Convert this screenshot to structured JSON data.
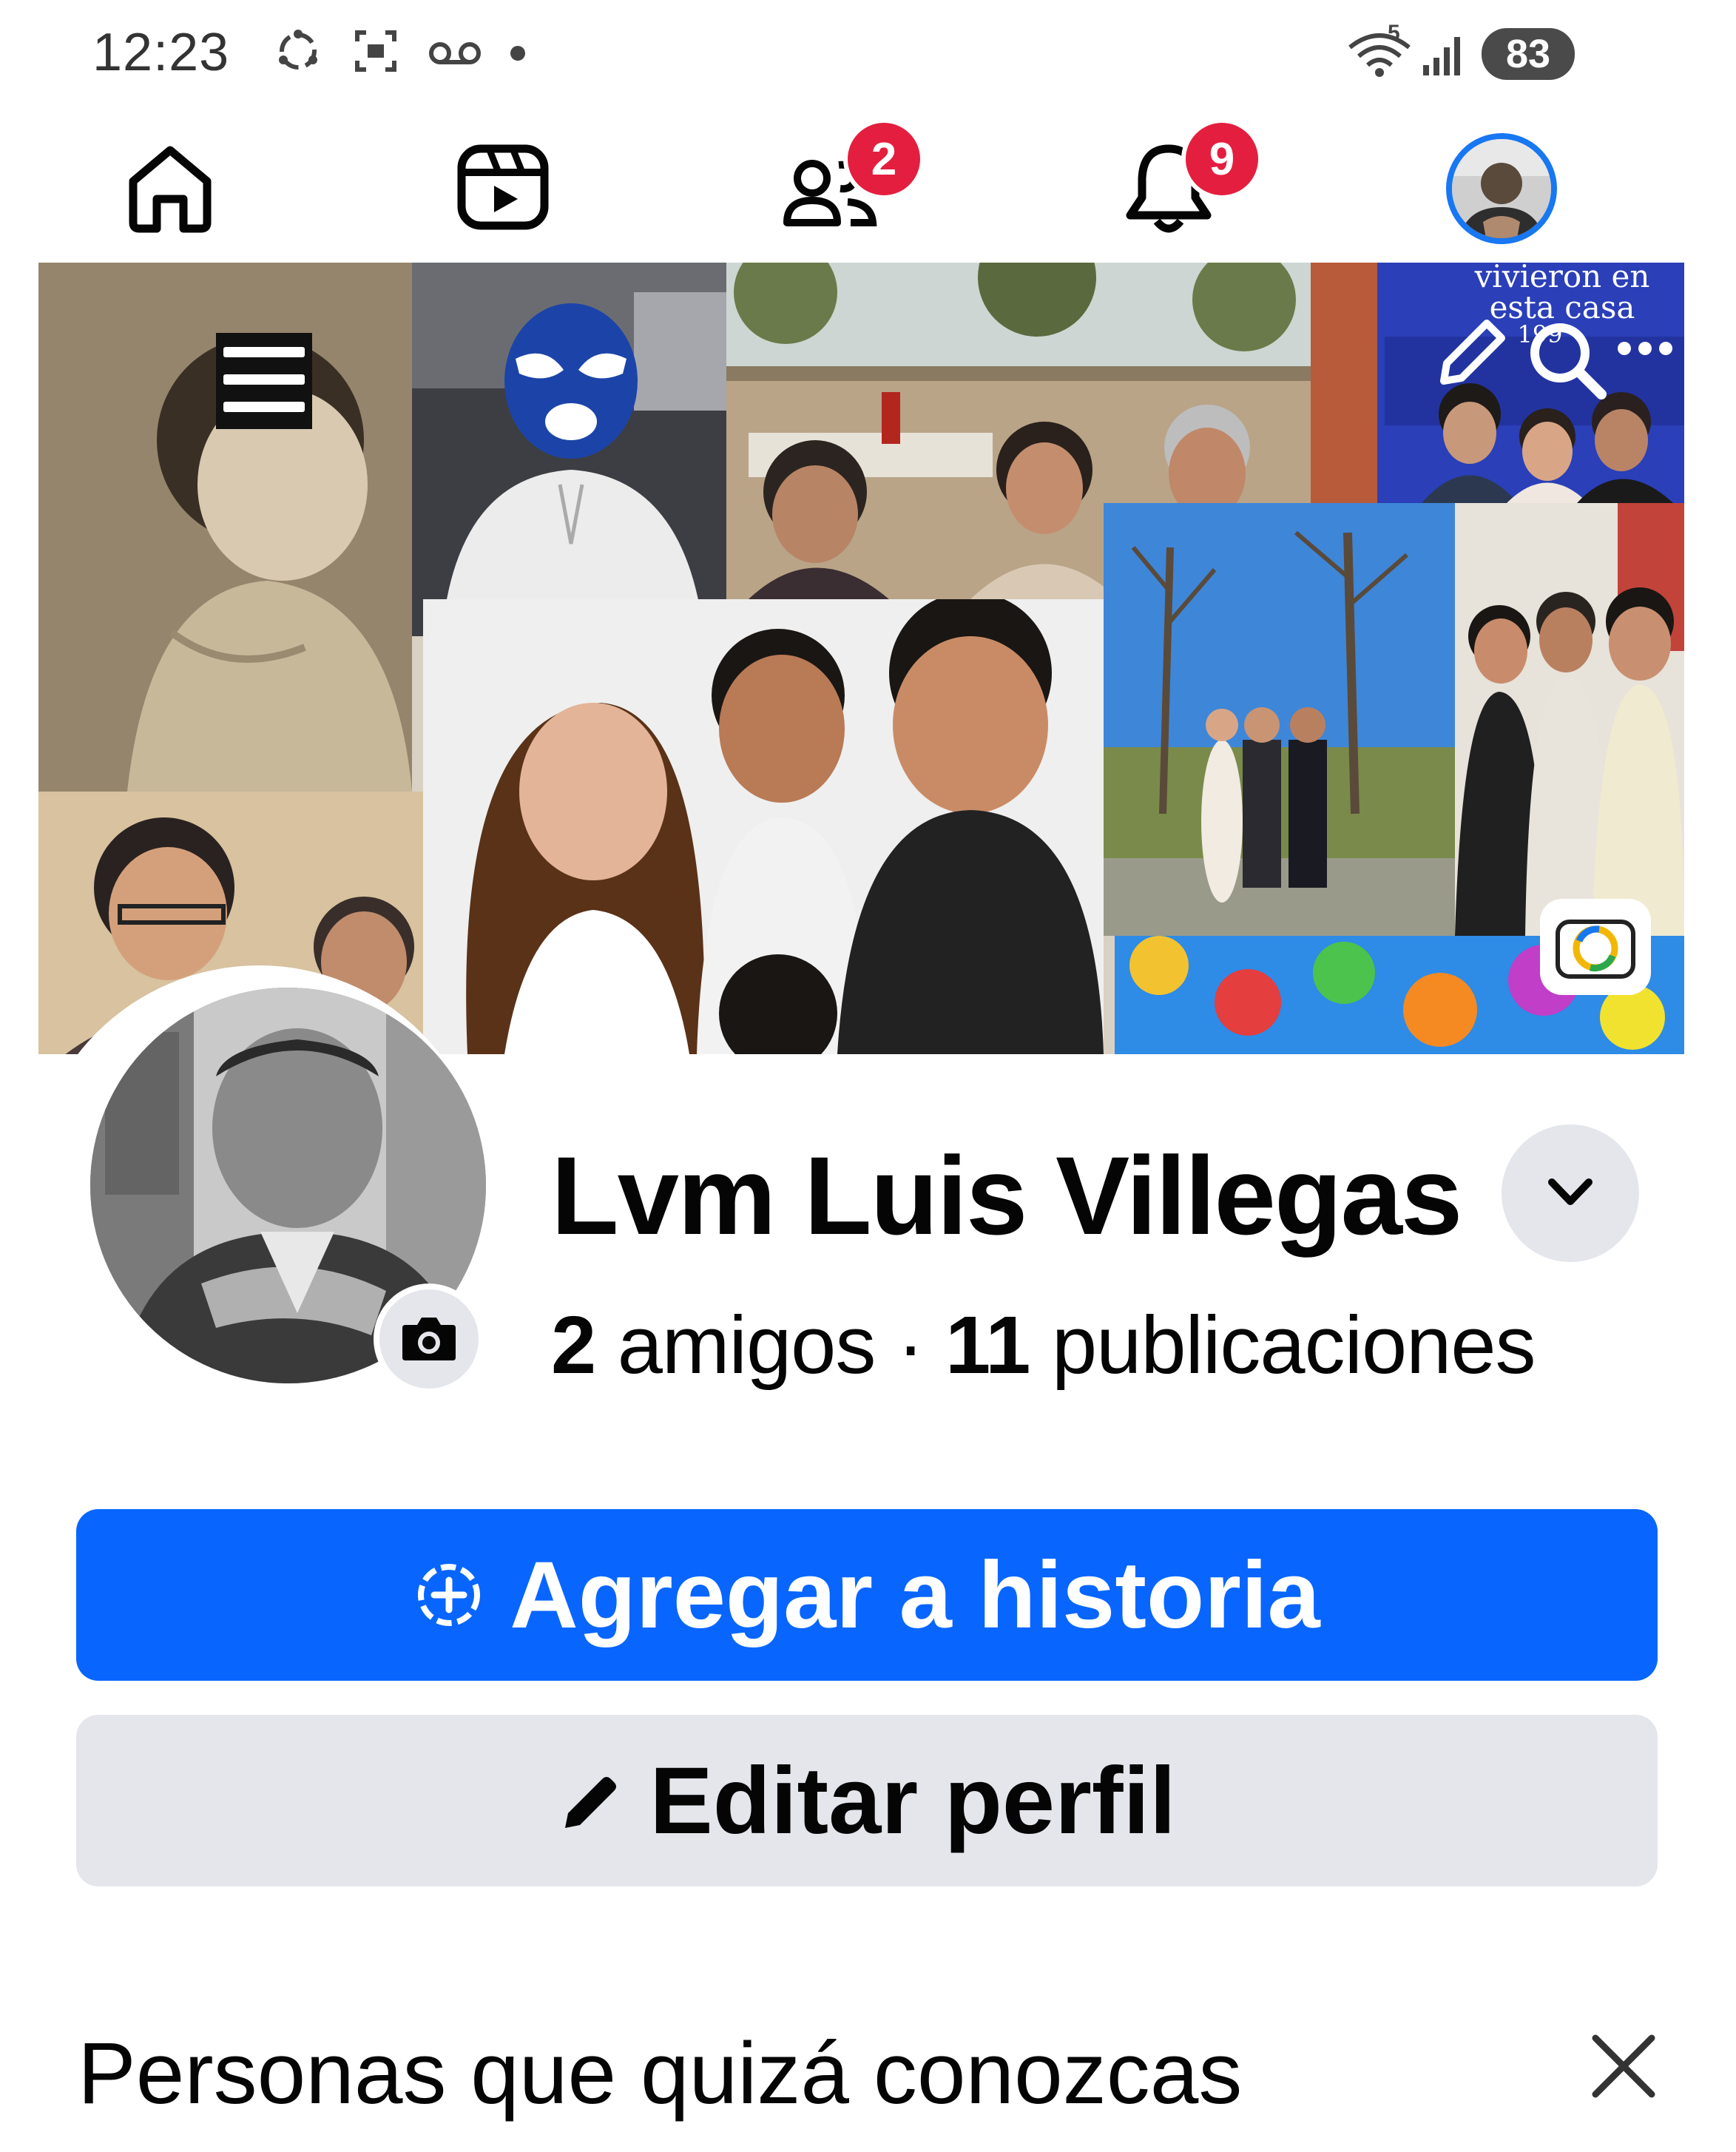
{
  "status_bar": {
    "time": "12:23",
    "left_icons": [
      "sync-icon",
      "screen-record-icon",
      "voicemail-icon",
      "dot-icon"
    ],
    "right_icons": [
      "wifi-icon",
      "signal-icon"
    ],
    "wifi_label": "5",
    "battery": "83"
  },
  "nav": {
    "items": [
      {
        "name": "home",
        "icon": "home-icon"
      },
      {
        "name": "video",
        "icon": "video-icon"
      },
      {
        "name": "friends",
        "icon": "friends-icon",
        "badge": "2"
      },
      {
        "name": "notifications",
        "icon": "bell-icon",
        "badge": "9"
      },
      {
        "name": "profile",
        "icon": "avatar"
      }
    ],
    "active_color": "#1877f2",
    "badge_color": "#e41e3f"
  },
  "cover": {
    "text_line1": "vivieron en",
    "text_line2": "esta casa",
    "text_line3": "199",
    "controls": [
      "menu-icon",
      "pencil-icon",
      "search-icon",
      "more-icon",
      "camera-icon"
    ]
  },
  "profile": {
    "name": "Lvm Luis Villegas",
    "friends_count": "2",
    "friends_label": "amigos",
    "separator": "·",
    "posts_count": "11",
    "posts_label": "publicaciones"
  },
  "buttons": {
    "add_story": "Agregar a historia",
    "edit_profile": "Editar perfil",
    "primary_color": "#0866ff",
    "secondary_color": "#e4e6eb"
  },
  "suggestions": {
    "heading": "Personas que quizá conozcas"
  }
}
